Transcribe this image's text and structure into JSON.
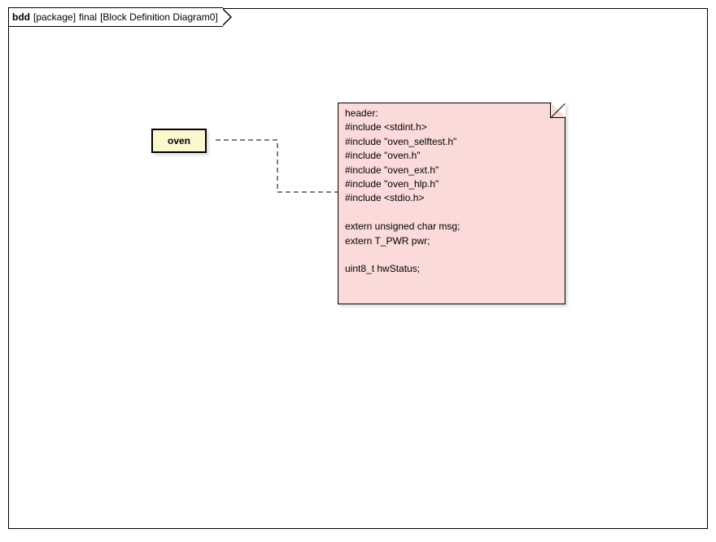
{
  "frame": {
    "kind": "bdd",
    "scope": "[package]",
    "name": "final",
    "suffix": "[Block Definition Diagram0]"
  },
  "block": {
    "name": "oven"
  },
  "note": {
    "text": "header:\n#include <stdint.h>\n#include \"oven_selftest.h\"\n#include \"oven.h\"\n#include \"oven_ext.h\"\n#include \"oven_hlp.h\"\n#include <stdio.h>\n\nextern unsigned char msg;\nextern T_PWR pwr;\n\nuint8_t hwStatus;\n"
  }
}
